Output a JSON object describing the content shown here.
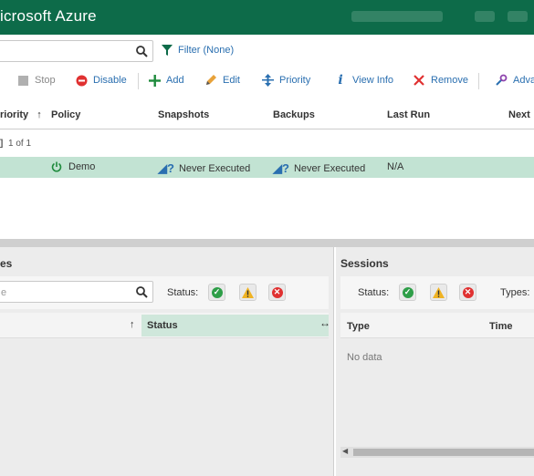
{
  "app": {
    "title": "icrosoft Azure"
  },
  "search": {
    "placeholder": "",
    "filter_label": "Filter (None)"
  },
  "toolbar": {
    "stop": "Stop",
    "disable": "Disable",
    "add": "Add",
    "edit": "Edit",
    "priority": "Priority",
    "view_info": "View Info",
    "remove": "Remove",
    "advanced": "Adva"
  },
  "grid": {
    "columns": [
      "riority",
      "Policy",
      "Snapshots",
      "Backups",
      "Last Run",
      "Next"
    ],
    "pager": "1 of 1",
    "rows": [
      {
        "policy": "Demo",
        "snapshots": "Never Executed",
        "backups": "Never Executed",
        "last_run": "N/A"
      }
    ]
  },
  "left_panel": {
    "title": "es",
    "search_placeholder": "e",
    "status_label": "Status:",
    "columns": [
      "Status"
    ]
  },
  "right_panel": {
    "title": "Sessions",
    "status_label": "Status:",
    "types_label": "Types:",
    "columns": [
      "Type",
      "Time"
    ],
    "empty_text": "No data"
  },
  "colors": {
    "titlebar": "#0d6b49",
    "selected_row": "#c2e3d3",
    "link": "#2a6fb0"
  }
}
